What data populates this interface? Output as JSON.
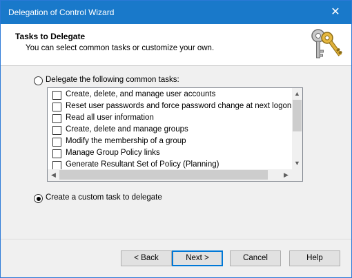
{
  "window": {
    "title": "Delegation of Control Wizard",
    "close_glyph": "✕"
  },
  "header": {
    "title": "Tasks to Delegate",
    "subtitle": "You can select common tasks or customize your own.",
    "icon": "keys-icon"
  },
  "options": {
    "common_tasks_label": "Delegate the following common tasks:",
    "common_tasks_selected": false,
    "custom_task_label": "Create a custom task to delegate",
    "custom_task_selected": true
  },
  "tasks": [
    {
      "label": "Create, delete, and manage user accounts",
      "checked": false
    },
    {
      "label": "Reset user passwords and force password change at next logon",
      "checked": false
    },
    {
      "label": "Read all user information",
      "checked": false
    },
    {
      "label": "Create, delete and manage groups",
      "checked": false
    },
    {
      "label": "Modify the membership of a group",
      "checked": false
    },
    {
      "label": "Manage Group Policy links",
      "checked": false
    },
    {
      "label": "Generate Resultant Set of Policy (Planning)",
      "checked": false
    }
  ],
  "buttons": {
    "back": "< Back",
    "next": "Next >",
    "cancel": "Cancel",
    "help": "Help"
  },
  "colors": {
    "titlebar": "#1979ca",
    "default_button_border": "#0078d7"
  }
}
